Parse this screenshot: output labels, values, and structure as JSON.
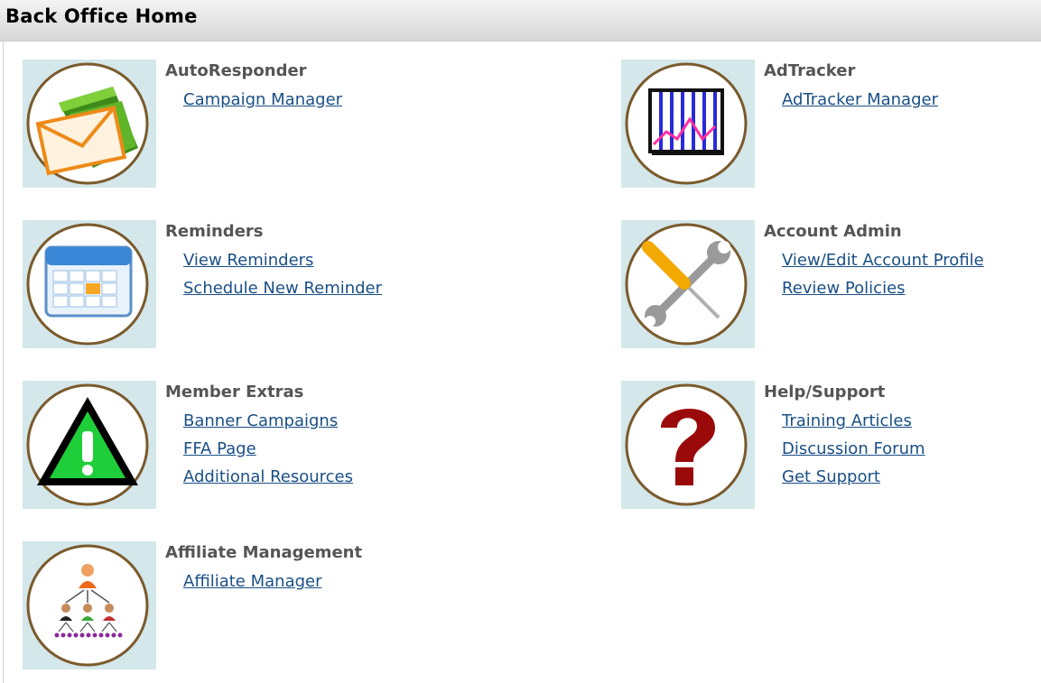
{
  "header": {
    "title": "Back Office Home"
  },
  "sections": [
    {
      "title": "AutoResponder",
      "icon": "envelope-folder-icon",
      "links": [
        "Campaign Manager"
      ]
    },
    {
      "title": "AdTracker",
      "icon": "line-chart-icon",
      "links": [
        "AdTracker Manager"
      ]
    },
    {
      "title": "Reminders",
      "icon": "calendar-icon",
      "links": [
        "View Reminders",
        "Schedule New Reminder"
      ]
    },
    {
      "title": "Account Admin",
      "icon": "tools-icon",
      "links": [
        "View/Edit Account Profile",
        "Review Policies"
      ]
    },
    {
      "title": "Member Extras",
      "icon": "warning-triangle-icon",
      "links": [
        "Banner Campaigns",
        "FFA Page",
        "Additional Resources"
      ]
    },
    {
      "title": "Help/Support",
      "icon": "question-mark-icon",
      "links": [
        "Training Articles",
        "Discussion Forum",
        "Get Support"
      ]
    },
    {
      "title": "Affiliate Management",
      "icon": "org-chart-icon",
      "links": [
        "Affiliate Manager"
      ]
    }
  ],
  "colors": {
    "icon_background": "#d4e7ea",
    "link": "#1a4f86",
    "section_title": "#555555"
  }
}
